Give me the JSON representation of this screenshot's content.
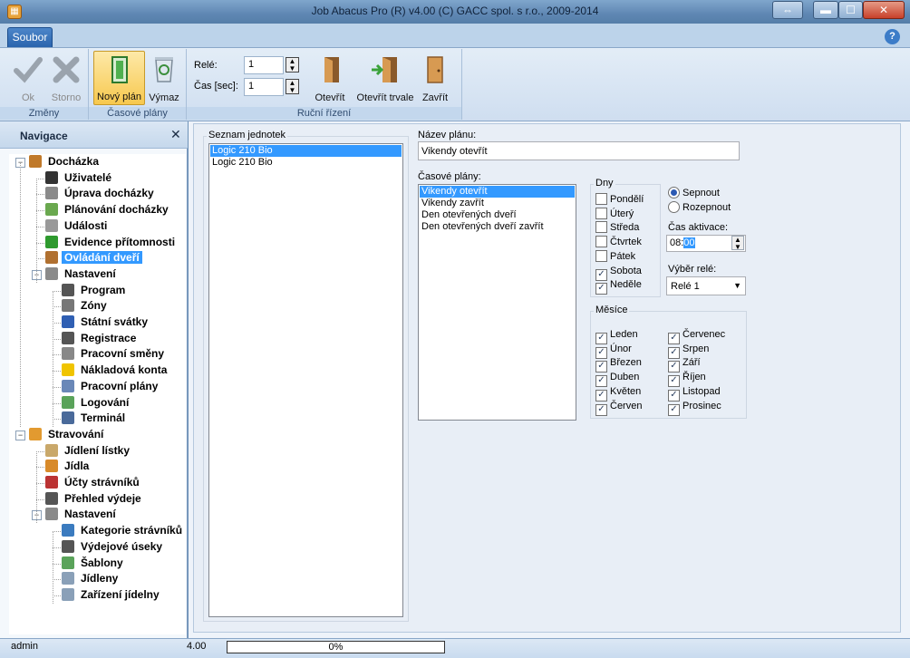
{
  "window": {
    "title": "Job Abacus Pro (R) v4.00 (C) GACC spol. s r.o., 2009-2014",
    "app_icon": "abacus-app-icon",
    "controls": {
      "restore": "⇔",
      "minimize": "▬",
      "maximize": "☐",
      "close": "✕"
    }
  },
  "ribbon": {
    "tab": "Soubor",
    "help": "?",
    "groups": {
      "zmeny": {
        "label": "Změny",
        "ok": "Ok",
        "storno": "Storno"
      },
      "casove_plany": {
        "label": "Časové plány",
        "novy_plan": "Nový plán",
        "vymaz": "Výmaz"
      },
      "rucni_rizeni": {
        "label": "Ruční řízení",
        "rele_label": "Relé:",
        "rele_value": "1",
        "cas_label": "Čas [sec]:",
        "cas_value": "1",
        "otevrit": "Otevřít",
        "otevrit_trvale": "Otevřít trvale",
        "zavrit": "Zavřít"
      }
    }
  },
  "navigation": {
    "title": "Navigace",
    "close": "✕",
    "items": [
      {
        "label": "Docházka",
        "level": 0,
        "icon": "attendance-icon",
        "expander": "−"
      },
      {
        "label": "Uživatelé",
        "level": 1,
        "icon": "user-icon"
      },
      {
        "label": "Úprava docházky",
        "level": 1,
        "icon": "edit-document-icon"
      },
      {
        "label": "Plánování docházky",
        "level": 1,
        "icon": "planning-icon"
      },
      {
        "label": "Události",
        "level": 1,
        "icon": "events-icon"
      },
      {
        "label": "Evidence přítomnosti",
        "level": 1,
        "icon": "checkmark-icon"
      },
      {
        "label": "Ovládání dveří",
        "level": 1,
        "icon": "door-icon",
        "selected": true
      },
      {
        "label": "Nastavení",
        "level": 1,
        "icon": "settings-tools-icon",
        "expander": "−"
      },
      {
        "label": "Program",
        "level": 2,
        "icon": "program-icon"
      },
      {
        "label": "Zóny",
        "level": 2,
        "icon": "zones-icon"
      },
      {
        "label": "Státní svátky",
        "level": 2,
        "icon": "flag-icon"
      },
      {
        "label": "Registrace",
        "level": 2,
        "icon": "registration-icon"
      },
      {
        "label": "Pracovní směny",
        "level": 2,
        "icon": "stopwatch-icon"
      },
      {
        "label": "Nákladová konta",
        "level": 2,
        "icon": "folder-icon"
      },
      {
        "label": "Pracovní plány",
        "level": 2,
        "icon": "work-plans-icon"
      },
      {
        "label": "Logování",
        "level": 2,
        "icon": "logging-icon"
      },
      {
        "label": "Terminál",
        "level": 2,
        "icon": "terminal-icon"
      },
      {
        "label": "Stravování",
        "level": 0,
        "icon": "burger-icon",
        "expander": "−"
      },
      {
        "label": "Jídlení lístky",
        "level": 1,
        "icon": "menu-card-icon"
      },
      {
        "label": "Jídla",
        "level": 1,
        "icon": "food-icon"
      },
      {
        "label": "Účty strávníků",
        "level": 1,
        "icon": "accounts-icon"
      },
      {
        "label": "Přehled výdeje",
        "level": 1,
        "icon": "overview-icon"
      },
      {
        "label": "Nastavení",
        "level": 1,
        "icon": "settings-tools-icon",
        "expander": "−"
      },
      {
        "label": "Kategorie strávníků",
        "level": 2,
        "icon": "categories-icon"
      },
      {
        "label": "Výdejové úseky",
        "level": 2,
        "icon": "clock-icon"
      },
      {
        "label": "Šablony",
        "level": 2,
        "icon": "templates-icon"
      },
      {
        "label": "Jídleny",
        "level": 2,
        "icon": "canteen-icon"
      },
      {
        "label": "Zařízení jídelny",
        "level": 2,
        "icon": "canteen-device-icon"
      }
    ]
  },
  "main": {
    "units": {
      "legend": "Seznam jednotek",
      "items": [
        "Logic 210 Bio",
        "Logic 210 Bio"
      ],
      "selected_index": 0
    },
    "plan_name": {
      "label": "Název plánu:",
      "value": "Vikendy otevřít"
    },
    "plans": {
      "label": "Časové plány:",
      "items": [
        "Vikendy otevřít",
        "Vikendy zavřít",
        "Den otevřených dveří",
        "Den otevřených dveří zavřít"
      ],
      "selected_index": 0
    },
    "days": {
      "legend": "Dny",
      "items": [
        {
          "label": "Pondělí",
          "checked": false
        },
        {
          "label": "Úterý",
          "checked": false
        },
        {
          "label": "Středa",
          "checked": false
        },
        {
          "label": "Čtvrtek",
          "checked": false
        },
        {
          "label": "Pátek",
          "checked": false
        },
        {
          "label": "Sobota",
          "checked": true
        },
        {
          "label": "Neděle",
          "checked": true
        }
      ]
    },
    "action": {
      "sepnout": "Sepnout",
      "rozepnout": "Rozepnout",
      "selected": "sepnout"
    },
    "activation": {
      "label": "Čas aktivace:",
      "hours": "08:",
      "minutes": "00"
    },
    "relay": {
      "label": "Výběr relé:",
      "value": "Relé 1"
    },
    "months": {
      "legend": "Měsíce",
      "items": [
        {
          "label": "Leden",
          "checked": true
        },
        {
          "label": "Únor",
          "checked": true
        },
        {
          "label": "Březen",
          "checked": true
        },
        {
          "label": "Duben",
          "checked": true
        },
        {
          "label": "Květen",
          "checked": true
        },
        {
          "label": "Červen",
          "checked": true
        },
        {
          "label": "Červenec",
          "checked": true
        },
        {
          "label": "Srpen",
          "checked": true
        },
        {
          "label": "Září",
          "checked": true
        },
        {
          "label": "Říjen",
          "checked": true
        },
        {
          "label": "Listopad",
          "checked": true
        },
        {
          "label": "Prosinec",
          "checked": true
        }
      ]
    }
  },
  "status": {
    "user": "admin",
    "version": "4.00",
    "progress_text": "0%",
    "progress_value": 0
  }
}
